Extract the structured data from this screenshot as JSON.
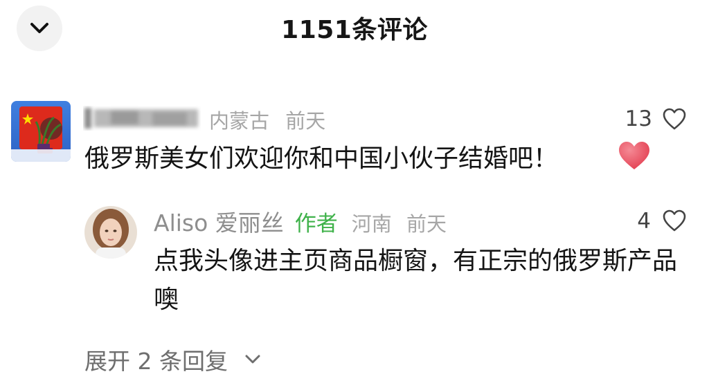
{
  "header": {
    "title": "1151条评论",
    "collapse_icon": "chevron-down-icon"
  },
  "comment": {
    "username": "",
    "location": "内蒙古",
    "time": "前天",
    "likes": "13",
    "text": "俄罗斯美女们欢迎你和中国小伙子结婚吧！",
    "emoji": "red-heart-emoji",
    "like_icon": "heart-outline-icon"
  },
  "reply": {
    "username": "Aliso 爱丽丝",
    "badge": "作者",
    "location": "河南",
    "time": "前天",
    "likes": "4",
    "text": "点我头像进主页商品橱窗，有正宗的俄罗斯产品噢",
    "like_icon": "heart-outline-icon"
  },
  "expand": {
    "label": "展开 2 条回复",
    "icon": "chevron-down-icon"
  },
  "colors": {
    "author_badge": "#3fb24a",
    "meta_gray": "#a6a6a6",
    "heart_red": "#e8495a"
  }
}
